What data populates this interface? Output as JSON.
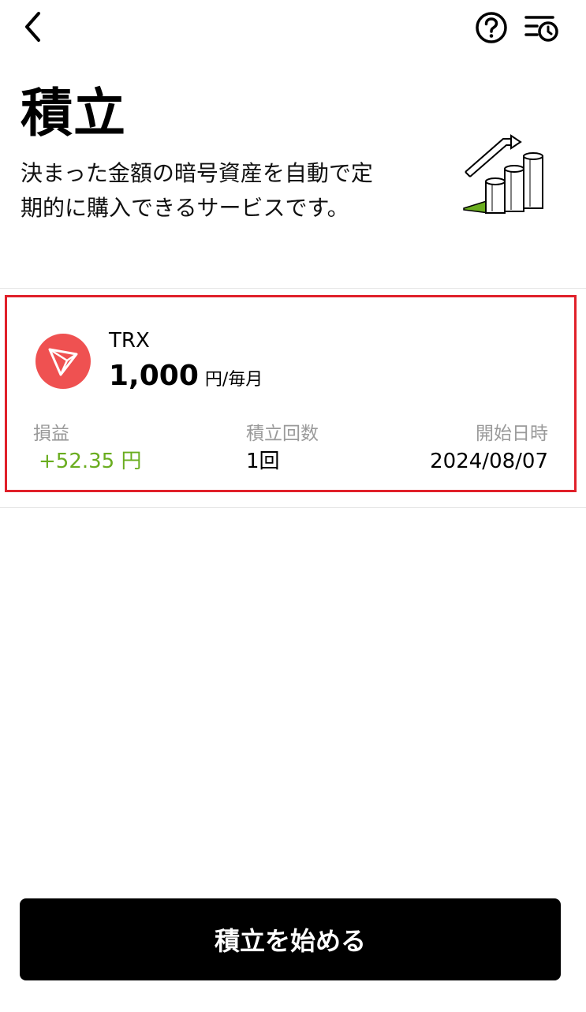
{
  "header": {
    "back_icon": "chevron-left-icon",
    "help_icon": "question-circle-icon",
    "history_icon": "list-clock-icon"
  },
  "page": {
    "title": "積立",
    "description_line1": "決まった金額の暗号資産を自動で定",
    "description_line2": "期的に購入できるサービスです。",
    "illustration_icon": "growth-chart-illustration"
  },
  "plan": {
    "coin_icon": "tron-logo-icon",
    "coin_name": "TRX",
    "amount": "1,000",
    "amount_unit": "円/毎月",
    "profit_label": "損益",
    "profit_value": "+52.35 円",
    "count_label": "積立回数",
    "count_value": "1回",
    "start_label": "開始日時",
    "start_value": "2024/08/07"
  },
  "footer": {
    "start_button_label": "積立を始める"
  },
  "colors": {
    "accent_red": "#e0202a",
    "tron_red": "#ef5151",
    "profit_green": "#6aad1f",
    "muted_gray": "#9a9a9a"
  }
}
